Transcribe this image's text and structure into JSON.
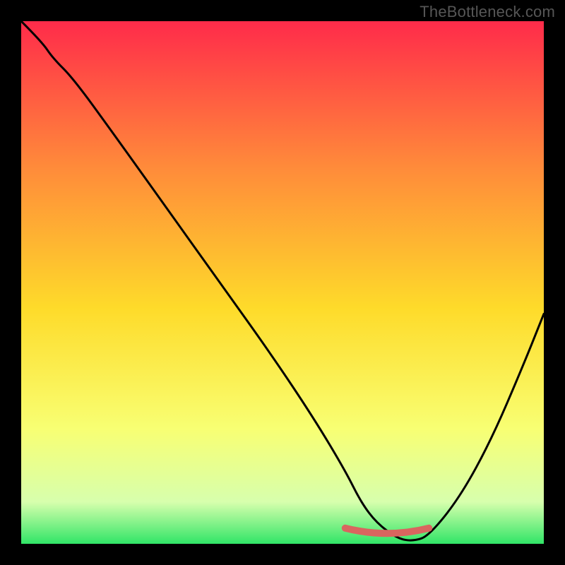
{
  "watermark": "TheBottleneck.com",
  "colors": {
    "frame": "#000000",
    "gradient_top": "#ff2b4a",
    "gradient_upper_mid": "#ff8b3a",
    "gradient_mid": "#fedb2a",
    "gradient_lower_mid": "#f8ff73",
    "gradient_near_bottom": "#d7ffad",
    "gradient_bottom": "#31e567",
    "curve": "#000000",
    "marker": "#d9655f"
  },
  "chart_data": {
    "type": "line",
    "title": "",
    "xlabel": "",
    "ylabel": "",
    "xlim": [
      0,
      100
    ],
    "ylim": [
      0,
      100
    ],
    "grid": false,
    "legend": false,
    "series": [
      {
        "name": "bottleneck-curve",
        "x": [
          0,
          4,
          6,
          10,
          18,
          28,
          38,
          48,
          56,
          62,
          65,
          68,
          72,
          75,
          78,
          84,
          90,
          96,
          100
        ],
        "values": [
          100,
          96,
          93,
          89,
          78,
          64,
          50,
          36,
          24,
          14,
          8,
          4,
          1,
          0.5,
          1.5,
          9,
          20,
          34,
          44
        ]
      }
    ],
    "flat_region": {
      "x_start": 62,
      "x_end": 78,
      "y": 1
    },
    "annotations": []
  }
}
